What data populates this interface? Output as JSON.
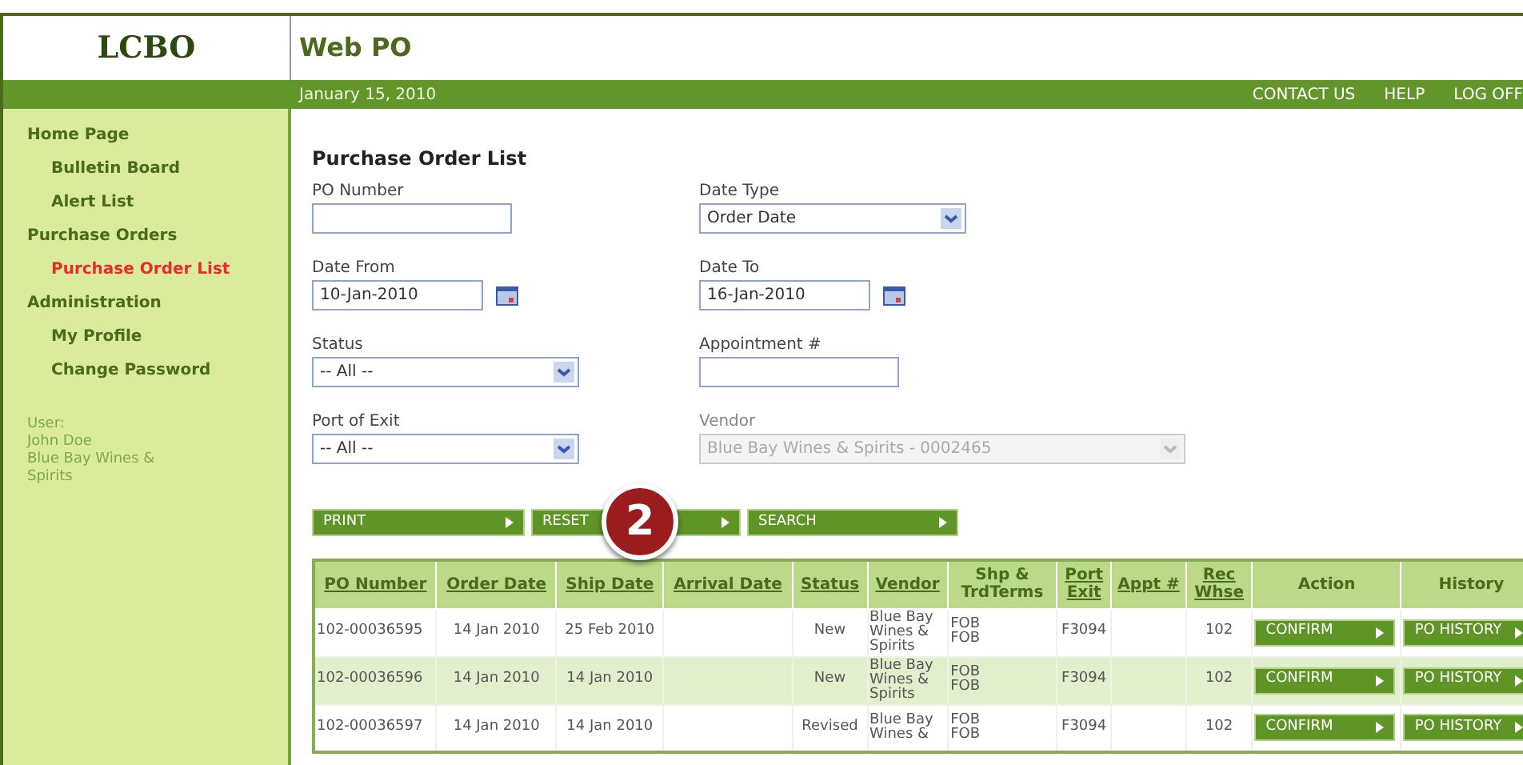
{
  "header": {
    "logo": "LCBO",
    "title": "Web PO"
  },
  "topbar": {
    "date": "January 15, 2010",
    "links": [
      "CONTACT US",
      "HELP",
      "LOG OFF"
    ]
  },
  "sidebar": {
    "items": [
      {
        "label": "Home Page",
        "selected": false,
        "children": [
          {
            "label": "Bulletin Board",
            "selected": false
          },
          {
            "label": "Alert List",
            "selected": false
          }
        ]
      },
      {
        "label": "Purchase Orders",
        "selected": false,
        "children": [
          {
            "label": "Purchase Order List",
            "selected": true
          }
        ]
      },
      {
        "label": "Administration",
        "selected": false,
        "children": [
          {
            "label": "My Profile",
            "selected": false
          },
          {
            "label": "Change Password",
            "selected": false
          }
        ]
      }
    ],
    "user": [
      "User:",
      "John Doe",
      "Blue Bay Wines & Spirits"
    ]
  },
  "page_title": "Purchase Order List",
  "fields": [
    {
      "label": "PO Number",
      "kind": "text",
      "disabled": false
    },
    {
      "label": "Date Type",
      "kind": "select",
      "value": "Order Date",
      "disabled": false
    },
    {
      "label": "Date From",
      "kind": "date",
      "value": "10-Jan-2010",
      "disabled": false
    },
    {
      "label": "Date To",
      "kind": "date",
      "value": "16-Jan-2010",
      "disabled": false
    },
    {
      "label": "Status",
      "kind": "select",
      "value": "-- All --",
      "disabled": false
    },
    {
      "label": "Appointment #",
      "kind": "text",
      "disabled": false
    },
    {
      "label": "Port of Exit",
      "kind": "select",
      "value": "-- All --",
      "disabled": false
    },
    {
      "label": "Vendor",
      "kind": "select",
      "value": "Blue Bay Wines & Spirits - 0002465",
      "disabled": true
    }
  ],
  "buttons": [
    "PRINT",
    "RESET",
    "SEARCH"
  ],
  "callout": "2",
  "table": {
    "columns": [
      {
        "label": "PO Number",
        "sortable": true
      },
      {
        "label": "Order Date",
        "sortable": true
      },
      {
        "label": "Ship Date",
        "sortable": true
      },
      {
        "label": "Arrival Date",
        "sortable": true
      },
      {
        "label": "Status",
        "sortable": true
      },
      {
        "label": "Vendor",
        "sortable": true
      },
      {
        "label": "Shp & TrdTerms",
        "sortable": false
      },
      {
        "label": "Port Exit",
        "sortable": true
      },
      {
        "label": "Appt #",
        "sortable": true
      },
      {
        "label": "Rec Whse",
        "sortable": true
      },
      {
        "label": "Action",
        "sortable": false
      },
      {
        "label": "History",
        "sortable": false
      }
    ],
    "rows": [
      {
        "cells": [
          "102-00036595",
          "14 Jan 2010",
          "25 Feb 2010",
          "",
          "New",
          "Blue Bay Wines & Spirits",
          "FOB FOB",
          "F3094",
          "",
          "102"
        ],
        "action": "CONFIRM",
        "history": "PO HISTORY"
      },
      {
        "cells": [
          "102-00036596",
          "14 Jan 2010",
          "14 Jan 2010",
          "",
          "New",
          "Blue Bay Wines & Spirits",
          "FOB FOB",
          "F3094",
          "",
          "102"
        ],
        "action": "CONFIRM",
        "history": "PO HISTORY"
      },
      {
        "cells": [
          "102-00036597",
          "14 Jan 2010",
          "14 Jan 2010",
          "",
          "Revised",
          "Blue Bay Wines &",
          "FOB FOB",
          "F3094",
          "",
          "102"
        ],
        "action": "CONFIRM",
        "history": "PO HISTORY"
      }
    ]
  }
}
